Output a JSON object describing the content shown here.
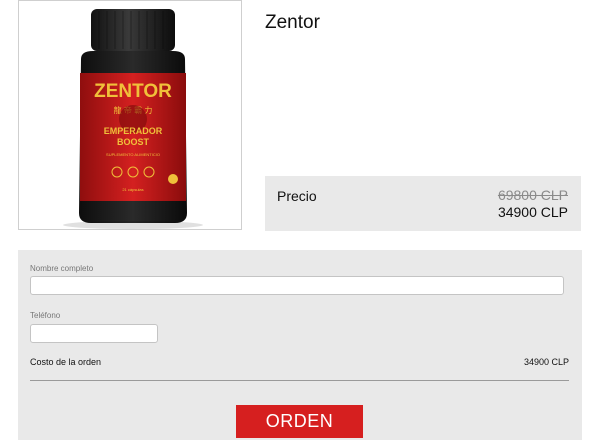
{
  "product": {
    "title": "Zentor",
    "image": {
      "brand": "ZENTOR",
      "line1": "EMPERADOR",
      "line2": "BOOST",
      "subtitle": "SUPLEMENTO ALIMENTICIO",
      "count": "21 cápsulas",
      "colors": {
        "label_red": "#c81818",
        "cap": "#1a1a1a",
        "gold": "#e6b32e"
      }
    }
  },
  "price": {
    "label": "Precio",
    "old": "69800 CLP",
    "new": "34900 CLP"
  },
  "form": {
    "name_label": "Nombre completo",
    "name_value": "",
    "phone_label": "Teléfono",
    "phone_value": "",
    "cost_label": "Costo de la orden",
    "cost_value": "34900 CLP",
    "submit_label": "ORDEN"
  },
  "colors": {
    "accent": "#d61f1f",
    "panel": "#e9e9e9"
  }
}
